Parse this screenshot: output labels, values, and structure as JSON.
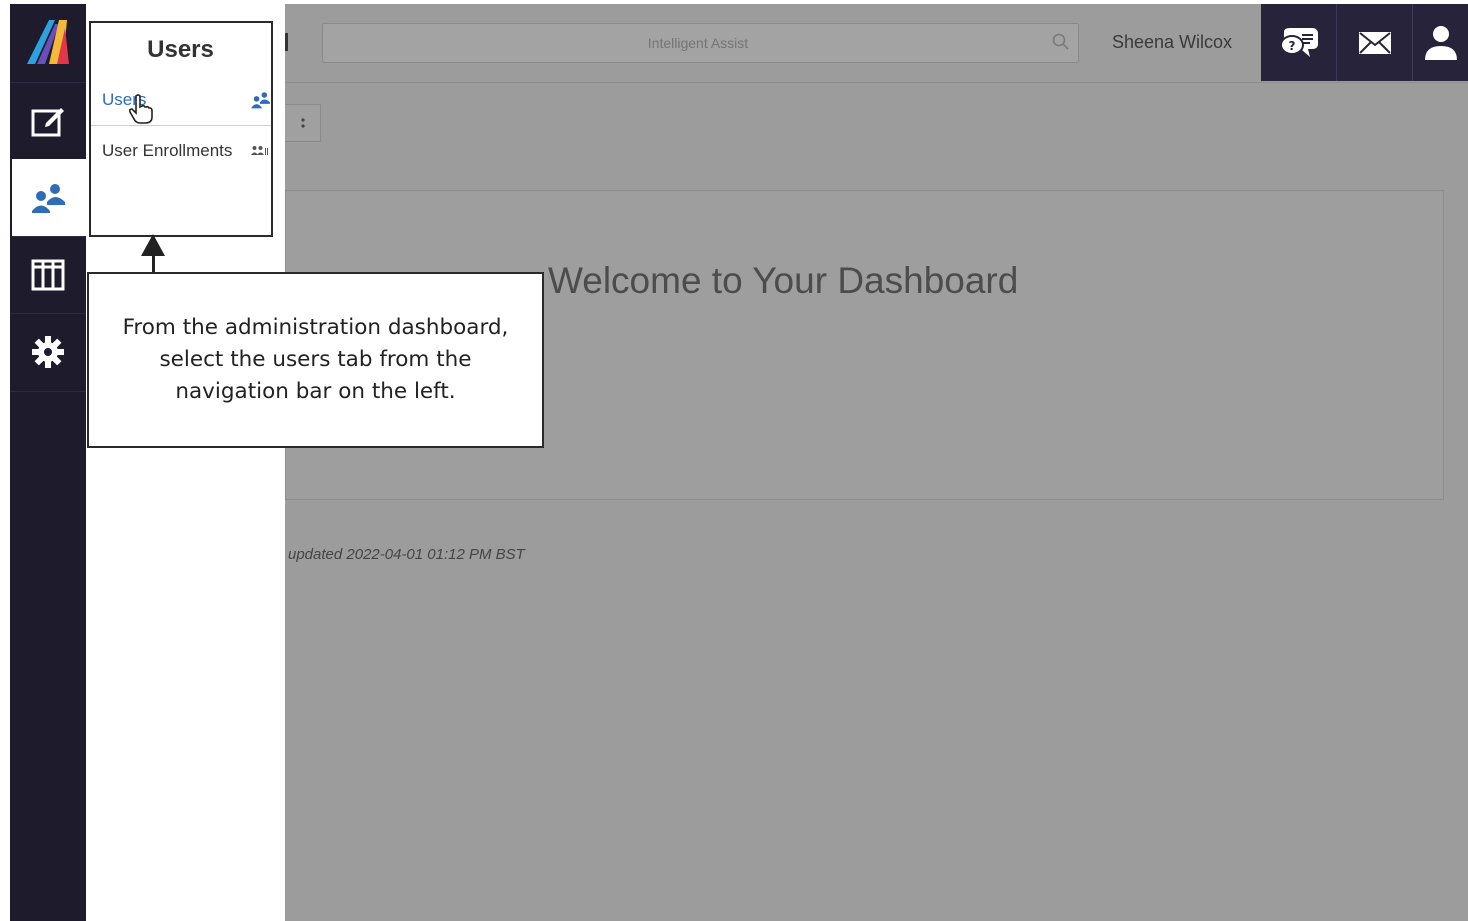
{
  "flyout": {
    "title": "Users",
    "items": [
      {
        "label": "Users",
        "icon": "users-icon"
      },
      {
        "label": "User Enrollments",
        "icon": "user-enrollments-icon"
      }
    ]
  },
  "sidebar": {
    "items": [
      {
        "name": "edit",
        "icon": "edit-icon"
      },
      {
        "name": "users",
        "icon": "users-icon",
        "active": true
      },
      {
        "name": "columns",
        "icon": "columns-icon"
      },
      {
        "name": "settings",
        "icon": "gear-icon"
      }
    ]
  },
  "header": {
    "search_placeholder": "Intelligent Assist",
    "user_name": "Sheena Wilcox"
  },
  "main": {
    "welcome": "Welcome to Your Dashboard",
    "updated": "updated 2022-04-01 01:12 PM BST"
  },
  "callout": {
    "text": "From the administration dashboard, select the users tab from the navigation bar on the left."
  },
  "colors": {
    "rail": "#1e1b2d",
    "link": "#2f6cb8",
    "overlay": "#9c9c9c"
  }
}
